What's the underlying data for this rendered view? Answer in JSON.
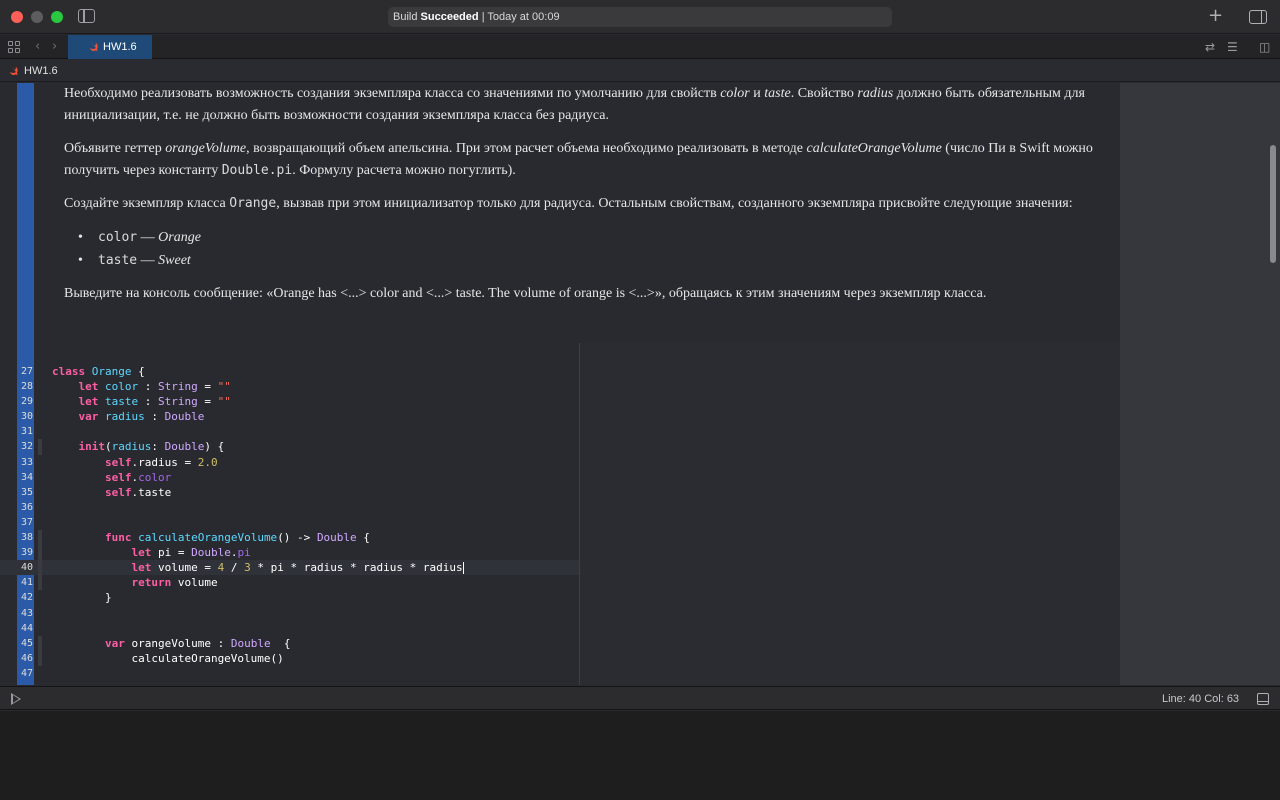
{
  "window": {
    "activity_status": "Build",
    "activity_result": "Succeeded",
    "activity_time": "| Today at 00:09"
  },
  "tabs": [
    {
      "label": "HW1.6",
      "active": true
    }
  ],
  "breadcrumb": {
    "file": "HW1.6"
  },
  "doc": {
    "p1": {
      "a": "Необходимо реализовать возможность создания экземпляра класса со значениями по умолчанию для свойств ",
      "color": "color",
      "and": " и ",
      "taste": "taste",
      "b": ". Свойство ",
      "radius": "radius",
      "c": " должно быть обязательным для инициализации, т.е. не должно быть возможности создания экземпляра класса без радиуса."
    },
    "p2": {
      "a": "Объявите геттер ",
      "getter": "orangeVolume",
      "b": ", возвращающий объем апельсина. При этом расчет объема необходимо реализовать в методе ",
      "method": "calculateOrangeVolume",
      "c": " (число Пи в Swift можно получить через константу ",
      "const": "Double.pi",
      "d": ". Формулу расчета можно погуглить)."
    },
    "p3": {
      "a": "Создайте экземпляр класса ",
      "cls": "Orange",
      "b": ", вызвав при этом инициализатор только для радиуса. Остальным свойствам, созданного экземпляра присвойте следующие значения:"
    },
    "bullets": [
      {
        "code": "color",
        "dash": " — ",
        "value": "Orange"
      },
      {
        "code": "taste",
        "dash": " — ",
        "value": "Sweet"
      }
    ],
    "p4": "Выведите на консоль сообщение: «Orange has <...> color and <...> taste. The volume of orange is <...>», обращаясь к этим значениям через экземпляр класса."
  },
  "code_lines": [
    {
      "n": "27",
      "t": [
        "class",
        " ",
        "Orange",
        " {"
      ]
    },
    {
      "n": "28",
      "t": [
        "    ",
        "let",
        " ",
        "color",
        " : ",
        "String",
        " = ",
        "\"\""
      ]
    },
    {
      "n": "29",
      "t": [
        "    ",
        "let",
        " ",
        "taste",
        " : ",
        "String",
        " = ",
        "\"\""
      ]
    },
    {
      "n": "30",
      "t": [
        "    ",
        "var",
        " ",
        "radius",
        " : ",
        "Double"
      ]
    },
    {
      "n": "31",
      "t": [
        ""
      ]
    },
    {
      "n": "32",
      "t": [
        "    ",
        "init",
        "(",
        "radius",
        ": ",
        "Double",
        ") {"
      ]
    },
    {
      "n": "33",
      "t": [
        "        ",
        "self",
        ".radius = ",
        "2.0"
      ]
    },
    {
      "n": "34",
      "t": [
        "        ",
        "self",
        ".",
        "color"
      ]
    },
    {
      "n": "35",
      "t": [
        "        ",
        "self",
        ".taste"
      ]
    },
    {
      "n": "36",
      "t": [
        ""
      ]
    },
    {
      "n": "37",
      "t": [
        ""
      ]
    },
    {
      "n": "38",
      "t": [
        "        ",
        "func",
        " ",
        "calculateOrangeVolume",
        "() -> ",
        "Double",
        " {"
      ]
    },
    {
      "n": "39",
      "t": [
        "            ",
        "let",
        " pi = ",
        "Double",
        ".",
        "pi"
      ]
    },
    {
      "n": "40",
      "t": [
        "            ",
        "let",
        " volume = ",
        "4",
        " / ",
        "3",
        " * pi * radius * radius * radius"
      ]
    },
    {
      "n": "41",
      "t": [
        "            ",
        "return",
        " volume"
      ]
    },
    {
      "n": "42",
      "t": [
        "        }"
      ]
    },
    {
      "n": "43",
      "t": [
        ""
      ]
    },
    {
      "n": "44",
      "t": [
        ""
      ]
    },
    {
      "n": "45",
      "t": [
        "        ",
        "var",
        " orangeVolume : ",
        "Double",
        "  {"
      ]
    },
    {
      "n": "46",
      "t": [
        "            calculateOrangeVolume()"
      ]
    },
    {
      "n": "47",
      "t": [
        ""
      ]
    }
  ],
  "status_bar": {
    "position": "Line: 40  Col: 63"
  },
  "colors": {
    "keyword": "#fc5fa3",
    "type": "#d0a8ff",
    "string": "#fc6a5d",
    "number": "#d0bf69",
    "declaration": "#5dd8ff",
    "tab_active": "#1f4a78"
  },
  "icons": [
    "sidebar-icon",
    "plus-icon",
    "inspector-icon",
    "grid-icon",
    "chevron-left-icon",
    "chevron-right-icon",
    "swift-icon",
    "swap-icon",
    "lines-icon",
    "split-icon",
    "play-icon",
    "console-icon"
  ]
}
